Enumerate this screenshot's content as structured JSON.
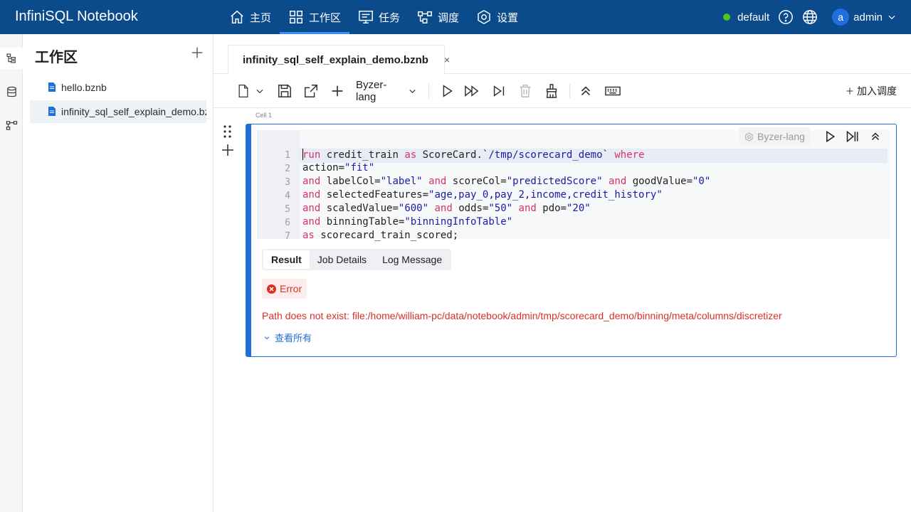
{
  "app": {
    "title": "InfiniSQL Notebook"
  },
  "nav": [
    {
      "label": "主页",
      "icon": "home-icon"
    },
    {
      "label": "工作区",
      "icon": "workspace-grid-icon",
      "active": true
    },
    {
      "label": "任务",
      "icon": "monitor-icon"
    },
    {
      "label": "调度",
      "icon": "schedule-icon"
    },
    {
      "label": "设置",
      "icon": "gear-icon"
    }
  ],
  "topright": {
    "env": "default",
    "avatar": "a",
    "user": "admin"
  },
  "sidebar": {
    "title": "工作区",
    "files": [
      {
        "name": "hello.bznb"
      },
      {
        "name": "infinity_sql_self_explain_demo.bznb",
        "active": true
      }
    ]
  },
  "editor": {
    "tab": {
      "label": "infinity_sql_self_explain_demo.bznb",
      "close": "×"
    },
    "toolbar": {
      "language": "Byzer-lang",
      "schedule": "加入调度"
    }
  },
  "cell": {
    "label": "Cell 1",
    "language": "Byzer-lang",
    "line_numbers": [
      "1",
      "2",
      "3",
      "4",
      "5",
      "6",
      "7"
    ],
    "code": [
      "run credit_train as ScoreCard.`/tmp/scorecard_demo` where",
      "action=\"fit\"",
      "and labelCol=\"label\" and scoreCol=\"predictedScore\" and goodValue=\"0\"",
      "and selectedFeatures=\"age,pay_0,pay_2,income,credit_history\"",
      "and scaledValue=\"600\" and odds=\"50\" and pdo=\"20\"",
      "and binningTable=\"binningInfoTable\"",
      "as scorecard_train_scored;"
    ],
    "result_tabs": [
      "Result",
      "Job Details",
      "Log Message"
    ],
    "status": "Error",
    "error_message": "Path does not exist: file:/home/william-pc/data/notebook/admin/tmp/scorecard_demo/binning/meta/columns/discretizer",
    "view_all": "查看所有"
  },
  "colors": {
    "brand": "#0b4a8b",
    "accent": "#1e6fd9",
    "error": "#d93025",
    "keyword": "#d6336c",
    "string": "#1a1aa6"
  }
}
